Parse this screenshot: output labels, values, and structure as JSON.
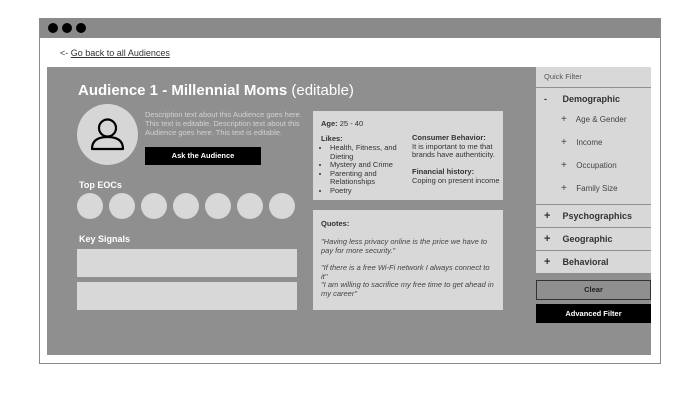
{
  "back_link": {
    "arrow": "<-",
    "label": "Go back to all Audiences"
  },
  "audience": {
    "name": "Audience 1 - Millennial Moms",
    "suffix": "(editable)",
    "description": "Description text about this Audience goes here. This text is editable. Description text about this Audience goes here. This text is editable.",
    "ask_button": "Ask the Audience"
  },
  "sections": {
    "top_eocs": "Top EOCs",
    "key_signals": "Key Signals"
  },
  "profile_card": {
    "age_label": "Age:",
    "age_value": "25 - 40",
    "likes_label": "Likes:",
    "likes": [
      "Health, Fitness, and Dieting",
      "Mystery and Crime",
      "Parenting and Relationships",
      "Poetry"
    ],
    "consumer_label": "Consumer Behavior:",
    "consumer_text": "It is important to me that brands have authenticity.",
    "financial_label": "Financial history:",
    "financial_text": "Coping on present income"
  },
  "quotes_card": {
    "label": "Quotes:",
    "quotes": [
      "\"Having less privacy online is the price we have to pay for more security.\"",
      "\"If there is a free Wi-Fi network I always connect to it\"",
      "\"I am willing to sacrifice my free time to get ahead in my career\""
    ]
  },
  "quick_filter": {
    "title": "Quick Filter",
    "demographic": {
      "symbol": "-",
      "label": "Demographic",
      "items": [
        {
          "symbol": "+",
          "label": "Age & Gender"
        },
        {
          "symbol": "+",
          "label": "Income"
        },
        {
          "symbol": "+",
          "label": "Occupation"
        },
        {
          "symbol": "+",
          "label": "Family Size"
        }
      ]
    },
    "categories": [
      {
        "symbol": "+",
        "label": "Psychographics"
      },
      {
        "symbol": "+",
        "label": "Geographic"
      },
      {
        "symbol": "+",
        "label": "Behavioral"
      }
    ],
    "clear_button": "Clear",
    "advanced_button": "Advanced Filter"
  },
  "colors": {
    "background": "#8f8f8f",
    "card": "#d8d8d8",
    "button": "#000000"
  }
}
